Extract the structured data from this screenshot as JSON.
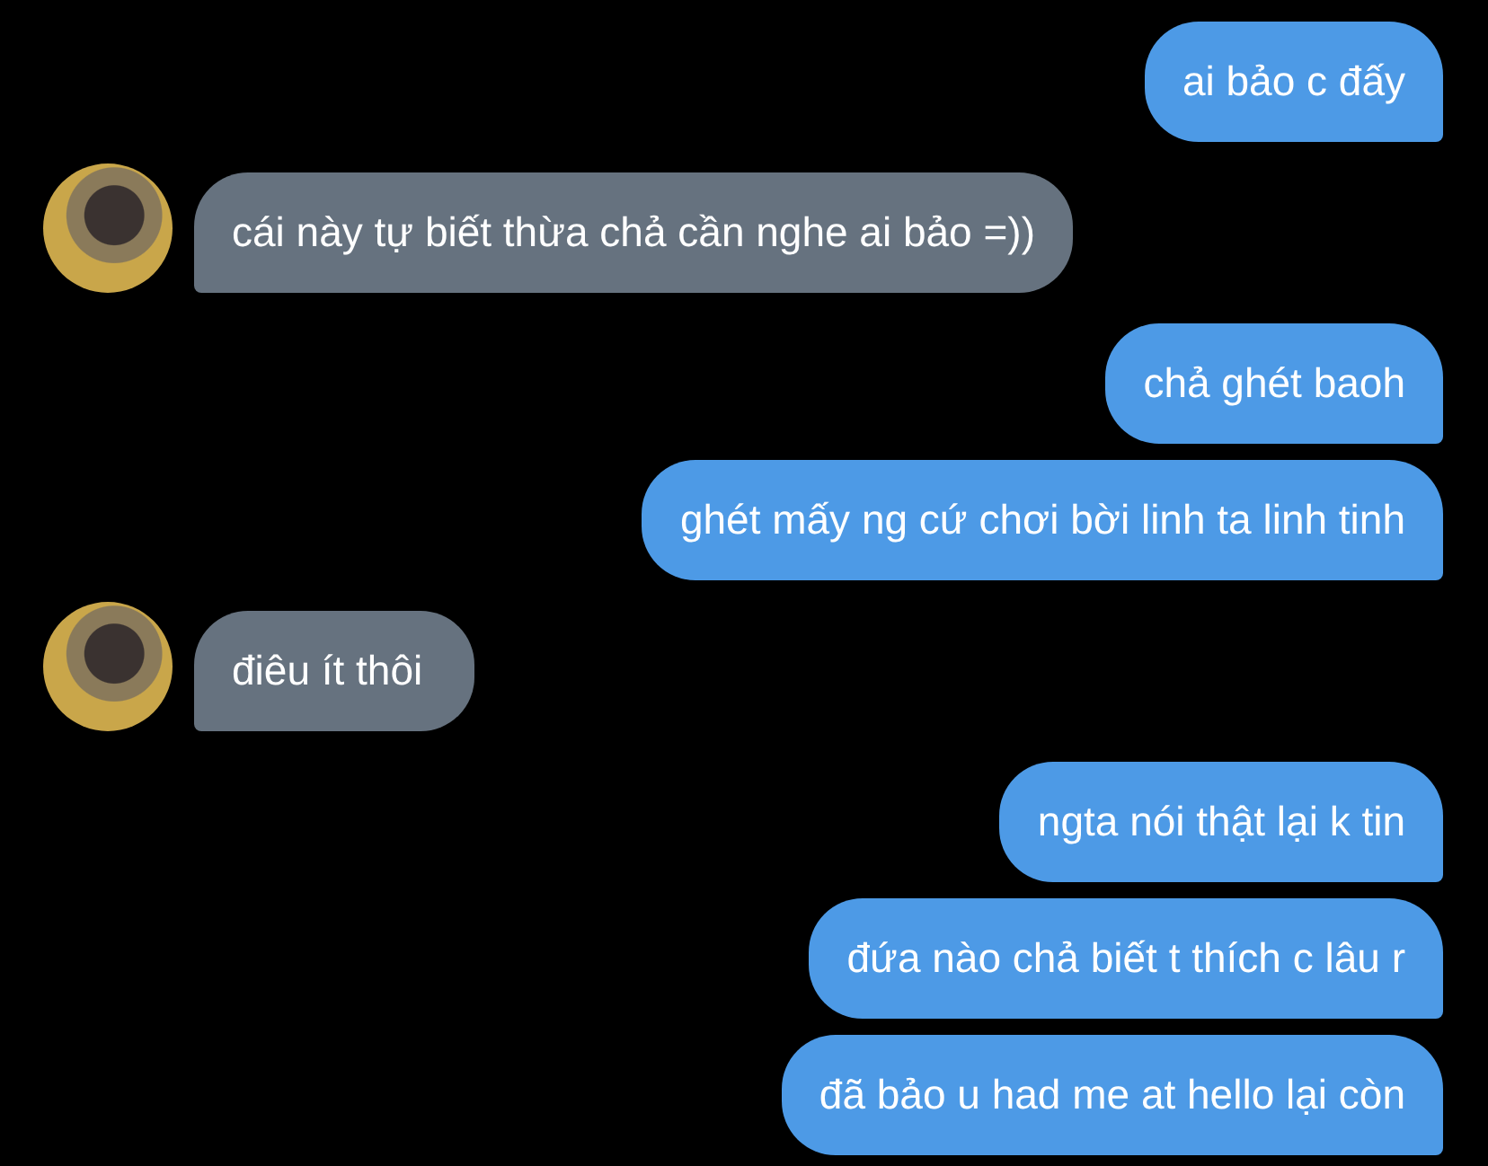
{
  "messages": [
    {
      "kind": "outgoing",
      "text": "ai bảo c đấy"
    },
    {
      "kind": "incoming",
      "text": "cái này tự biết thừa chả cần nghe ai bảo =))"
    },
    {
      "kind": "outgoing",
      "text": "chả ghét baoh"
    },
    {
      "kind": "outgoing",
      "text": "ghét mấy ng cứ chơi bời linh ta linh tinh"
    },
    {
      "kind": "incoming",
      "text": "điêu ít thôi"
    },
    {
      "kind": "outgoing",
      "text": "ngta nói thật lại k tin"
    },
    {
      "kind": "outgoing",
      "text": "đứa nào chả biết t thích c lâu r"
    },
    {
      "kind": "outgoing",
      "text": "đã bảo u had me at hello lại còn"
    }
  ]
}
